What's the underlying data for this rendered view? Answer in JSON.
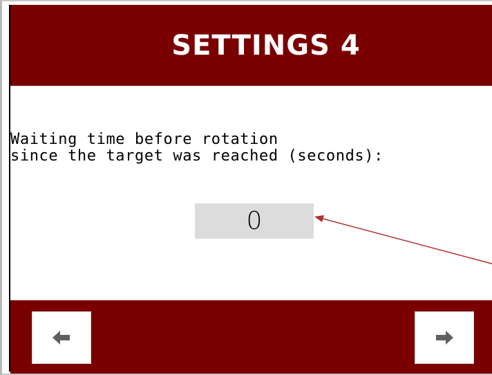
{
  "header": {
    "title": "SETTINGS 4"
  },
  "setting": {
    "description": "Waiting time before rotation\nsince the target was reached (seconds):",
    "value": "0"
  },
  "footer": {
    "prev_icon": "arrow-left-icon",
    "next_icon": "arrow-right-icon"
  },
  "colors": {
    "brand": "#7a0000",
    "value_box": "#dcdcdc",
    "annotation_arrow": "#b03030"
  }
}
